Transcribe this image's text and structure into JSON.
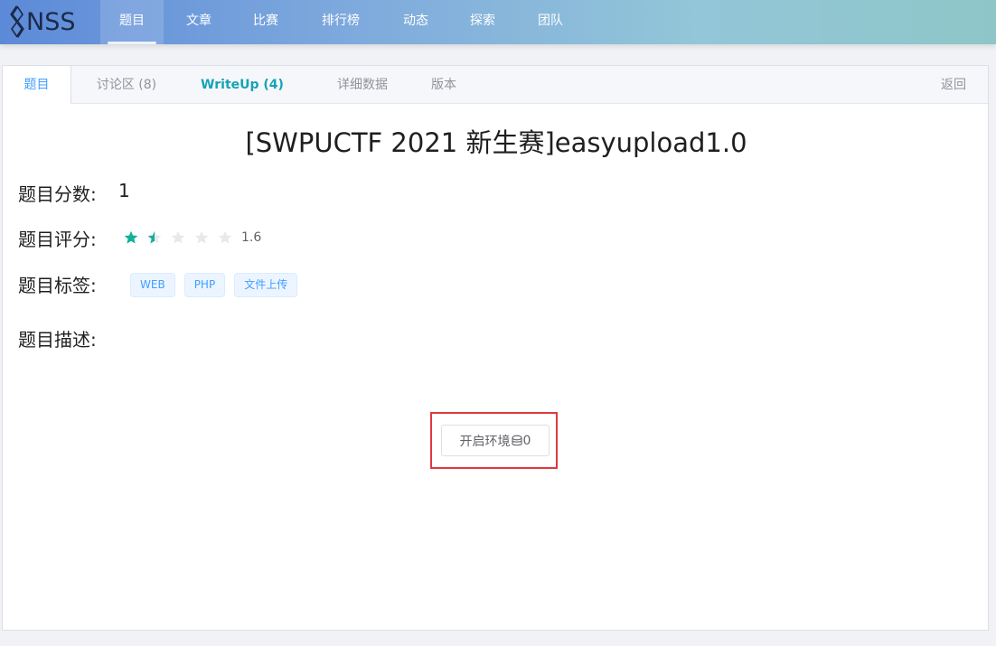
{
  "brand": {
    "name": "NSS"
  },
  "nav": {
    "items": [
      {
        "label": "题目",
        "active": true
      },
      {
        "label": "文章"
      },
      {
        "label": "比赛"
      },
      {
        "label": "排行榜"
      },
      {
        "label": "动态"
      },
      {
        "label": "探索"
      },
      {
        "label": "团队"
      }
    ]
  },
  "tabs": {
    "items": [
      {
        "label": "题目",
        "active": true
      },
      {
        "label": "讨论区 (8)"
      },
      {
        "label": "WriteUp (4)"
      },
      {
        "label": "详细数据"
      },
      {
        "label": "版本"
      }
    ],
    "return_label": "返回"
  },
  "problem": {
    "title": "[SWPUCTF 2021 新生赛]easyupload1.0",
    "score_label": "题目分数:",
    "score_value": "1",
    "rating_label": "题目评分:",
    "rating_value": "1.6",
    "rating_max": 5,
    "tags_label": "题目标签:",
    "tags": [
      "WEB",
      "PHP",
      "文件上传"
    ],
    "desc_label": "题目描述:"
  },
  "env_button": {
    "label": "开启环境",
    "cost": "0",
    "icon": "coin-stack-icon"
  },
  "colors": {
    "accent": "#409eff",
    "star_filled": "#13b09a",
    "writeup": "#17a2b8",
    "highlight_box": "#e0393e"
  }
}
